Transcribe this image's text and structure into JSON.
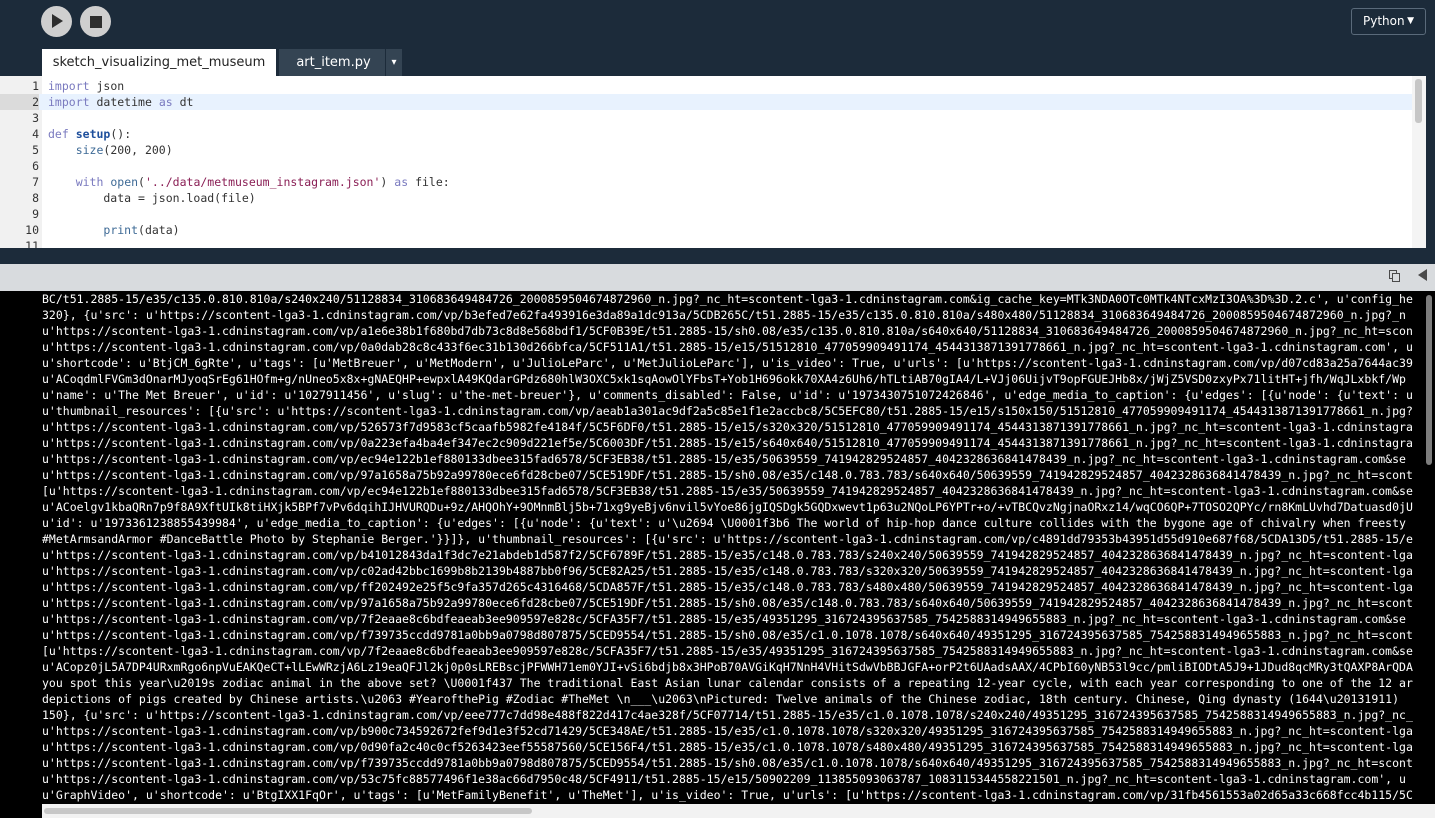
{
  "toolbar": {
    "run_icon": "play-icon",
    "stop_icon": "stop-icon",
    "mode": "Python",
    "mode_caret": "▼"
  },
  "tabs": [
    {
      "label": "sketch_visualizing_met_museum",
      "active": true
    },
    {
      "label": "art_item.py",
      "active": false
    }
  ],
  "tabs_menu": "▾",
  "editor": {
    "active_line": 2,
    "lines": [
      {
        "n": "1",
        "tokens": [
          [
            "kw",
            "import"
          ],
          [
            "",
            "json"
          ]
        ]
      },
      {
        "n": "2",
        "tokens": [
          [
            "kw",
            "import"
          ],
          [
            "",
            "datetime"
          ],
          [
            "kw",
            "as"
          ],
          [
            "",
            "dt"
          ]
        ]
      },
      {
        "n": "3",
        "tokens": []
      },
      {
        "n": "4",
        "tokens": [
          [
            "kw",
            "def"
          ],
          [
            "fn",
            "setup"
          ],
          [
            "",
            "():"
          ]
        ]
      },
      {
        "n": "5",
        "tokens": [
          [
            "",
            "    "
          ],
          [
            "bi",
            "size"
          ],
          [
            "",
            "(200, 200)"
          ]
        ]
      },
      {
        "n": "6",
        "tokens": []
      },
      {
        "n": "7",
        "tokens": [
          [
            "",
            "    "
          ],
          [
            "kw",
            "with"
          ],
          [
            "bi",
            "open"
          ],
          [
            "",
            "("
          ],
          [
            "str",
            "'../data/metmuseum_instagram.json'"
          ],
          [
            "",
            ")"
          ],
          [
            "kw",
            "as"
          ],
          [
            "",
            "file:"
          ]
        ]
      },
      {
        "n": "8",
        "tokens": [
          [
            "",
            "        data = json.load(file)"
          ]
        ]
      },
      {
        "n": "9",
        "tokens": []
      },
      {
        "n": "10",
        "tokens": [
          [
            "",
            "        "
          ],
          [
            "bi",
            "print"
          ],
          [
            "",
            "(data)"
          ]
        ]
      },
      {
        "n": "11",
        "tokens": []
      }
    ]
  },
  "console": {
    "copy_icon": "copy-icon",
    "collapse_icon": "collapse-left-icon",
    "lines": [
      "BC/t51.2885-15/e35/c135.0.810.810a/s240x240/51128834_310683649484726_2000859504674872960_n.jpg?_nc_ht=scontent-lga3-1.cdninstagram.com&ig_cache_key=MTk3NDA0OTc0MTk4NTcxMzI3OA%3D%3D.2.c', u'config_he",
      "320}, {u'src': u'https://scontent-lga3-1.cdninstagram.com/vp/b3efed7e62fa493916e3da89a1dc913a/5CDB265C/t51.2885-15/e35/c135.0.810.810a/s480x480/51128834_310683649484726_2000859504674872960_n.jpg?_n",
      "u'https://scontent-lga3-1.cdninstagram.com/vp/a1e6e38b1f680bd7db73c8d8e568bdf1/5CF0B39E/t51.2885-15/sh0.08/e35/c135.0.810.810a/s640x640/51128834_310683649484726_2000859504674872960_n.jpg?_nc_ht=scon",
      "u'https://scontent-lga3-1.cdninstagram.com/vp/0a0dab28c8c433f6ec31b130d266bfca/5CF511A1/t51.2885-15/e15/51512810_477059909491174_4544313871391778661_n.jpg?_nc_ht=scontent-lga3-1.cdninstagram.com', u",
      "u'shortcode': u'BtjCM_6gRte', u'tags': [u'MetBreuer', u'MetModern', u'JulioLeParc', u'MetJulioLeParc'], u'is_video': True, u'urls': [u'https://scontent-lga3-1.cdninstagram.com/vp/d07cd83a25a7644ac39",
      "u'ACoqdmlFVGm3dOnarMJyoqSrEg61HOfm+g/nUneo5x8x+gNAEQHP+ewpxlA49KQdarGPdz680hlW3OXC5xk1sqAowOlYFbsT+Yob1H696okk70XA4z6Uh6/hTLtiAB70gIA4/L+VJj06UijvT9opFGUEJHb8x/jWjZ5VSD0zxyPx71litHT+jfh/WqJLxbkf/Wp",
      "u'name': u'The Met Breuer', u'id': u'1027911456', u'slug': u'the-met-breuer'}, u'comments_disabled': False, u'id': u'1973430751072426846', u'edge_media_to_caption': {u'edges': [{u'node': {u'text': u",
      "u'thumbnail_resources': [{u'src': u'https://scontent-lga3-1.cdninstagram.com/vp/aeab1a301ac9df2a5c85e1f1e2accbc8/5C5EFC80/t51.2885-15/e15/s150x150/51512810_477059909491174_4544313871391778661_n.jpg?",
      "u'https://scontent-lga3-1.cdninstagram.com/vp/526573f7d9583cf5caafb5982fe4184f/5C5F6DF0/t51.2885-15/e15/s320x320/51512810_477059909491174_4544313871391778661_n.jpg?_nc_ht=scontent-lga3-1.cdninstagra",
      "u'https://scontent-lga3-1.cdninstagram.com/vp/0a223efa4ba4ef347ec2c909d221ef5e/5C6003DF/t51.2885-15/e15/s640x640/51512810_477059909491174_4544313871391778661_n.jpg?_nc_ht=scontent-lga3-1.cdninstagra",
      "u'https://scontent-lga3-1.cdninstagram.com/vp/ec94e122b1ef880133dbee315fad6578/5CF3EB38/t51.2885-15/e35/50639559_741942829524857_4042328636841478439_n.jpg?_nc_ht=scontent-lga3-1.cdninstagram.com&se",
      "u'https://scontent-lga3-1.cdninstagram.com/vp/97a1658a75b92a99780ece6fd28cbe07/5CE519DF/t51.2885-15/sh0.08/e35/c148.0.783.783/s640x640/50639559_741942829524857_4042328636841478439_n.jpg?_nc_ht=scont",
      "[u'https://scontent-lga3-1.cdninstagram.com/vp/ec94e122b1ef880133dbee315fad6578/5CF3EB38/t51.2885-15/e35/50639559_741942829524857_4042328636841478439_n.jpg?_nc_ht=scontent-lga3-1.cdninstagram.com&se",
      "u'ACoelgv1kbaQRn7p9f8A9XftUIk8tiHXjk5BPf7vPv6dqihIJHVURQDu+9z/AHQOhY+9OMnmBlj5b+71xg9yeBjv6nvil5vYoe86jgIQSDgk5GQDxwevt1p63u2NQoLP6YPTr+o/+vTBCQvzNgjnaORxz14/wqCO6QP+7TOSO2QPYc/rn8KmLUvhd7Datuasd0jU",
      "u'id': u'1973361238855439984', u'edge_media_to_caption': {u'edges': [{u'node': {u'text': u'\\u2694 \\U0001f3b6 The world of hip-hop dance culture collides with the bygone age of chivalry when freesty",
      "#MetArmsandArmor #DanceBattle Photo by Stephanie Berger.'}}]}, u'thumbnail_resources': [{u'src': u'https://scontent-lga3-1.cdninstagram.com/vp/c4891dd79353b43951d55d910e687f68/5CDA13D5/t51.2885-15/e",
      "u'https://scontent-lga3-1.cdninstagram.com/vp/b41012843da1f3dc7e21abdeb1d587f2/5CF6789F/t51.2885-15/e35/c148.0.783.783/s240x240/50639559_741942829524857_4042328636841478439_n.jpg?_nc_ht=scontent-lga",
      "u'https://scontent-lga3-1.cdninstagram.com/vp/c02ad42bbc1699b8b2139b4887bb0f96/5CE82A25/t51.2885-15/e35/c148.0.783.783/s320x320/50639559_741942829524857_4042328636841478439_n.jpg?_nc_ht=scontent-lga",
      "u'https://scontent-lga3-1.cdninstagram.com/vp/ff202492e25f5c9fa357d265c4316468/5CDA857F/t51.2885-15/e35/c148.0.783.783/s480x480/50639559_741942829524857_4042328636841478439_n.jpg?_nc_ht=scontent-lga",
      "u'https://scontent-lga3-1.cdninstagram.com/vp/97a1658a75b92a99780ece6fd28cbe07/5CE519DF/t51.2885-15/sh0.08/e35/c148.0.783.783/s640x640/50639559_741942829524857_4042328636841478439_n.jpg?_nc_ht=scont",
      "u'https://scontent-lga3-1.cdninstagram.com/vp/7f2eaae8c6bdfeaeab3ee909597e828c/5CFA35F7/t51.2885-15/e35/49351295_316724395637585_7542588314949655883_n.jpg?_nc_ht=scontent-lga3-1.cdninstagram.com&se",
      "u'https://scontent-lga3-1.cdninstagram.com/vp/f739735ccdd9781a0bb9a0798d807875/5CED9554/t51.2885-15/sh0.08/e35/c1.0.1078.1078/s640x640/49351295_316724395637585_7542588314949655883_n.jpg?_nc_ht=scont",
      "[u'https://scontent-lga3-1.cdninstagram.com/vp/7f2eaae8c6bdfeaeab3ee909597e828c/5CFA35F7/t51.2885-15/e35/49351295_316724395637585_7542588314949655883_n.jpg?_nc_ht=scontent-lga3-1.cdninstagram.com&se",
      "u'ACopz0jL5A7DP4URxmRgo6npVuEAKQeCT+lLEwWRzjA6Lz19eaQFJl2kj0p0sLREBscjPFWWH71em0YJI+vSi6bdjb8x3HPoB70AVGiKqH7NnH4VHitSdwVbBBJGFA+orP2t6UAadsAAX/4CPbI60yNB53l9cc/pmliBIODtA5J9+1JDud8qcMRy3tQAXP8ArQDA",
      "you spot this year\\u2019s zodiac animal in the above set? \\U0001f437 The traditional East Asian lunar calendar consists of a repeating 12-year cycle, with each year corresponding to one of the 12 ar",
      "depictions of pigs created by Chinese artists.\\u2063 #YearofthePig #Zodiac #TheMet \\n___\\u2063\\nPictured: Twelve animals of the Chinese zodiac, 18th century. Chinese, Qing dynasty (1644\\u20131911)",
      "150}, {u'src': u'https://scontent-lga3-1.cdninstagram.com/vp/eee777c7dd98e488f822d417c4ae328f/5CF07714/t51.2885-15/e35/c1.0.1078.1078/s240x240/49351295_316724395637585_7542588314949655883_n.jpg?_nc_",
      "u'https://scontent-lga3-1.cdninstagram.com/vp/b900c734592672fef9d1e3f52cd71429/5CE348AE/t51.2885-15/e35/c1.0.1078.1078/s320x320/49351295_316724395637585_7542588314949655883_n.jpg?_nc_ht=scontent-lga",
      "u'https://scontent-lga3-1.cdninstagram.com/vp/0d90fa2c40c0cf5263423eef55587560/5CE156F4/t51.2885-15/e35/c1.0.1078.1078/s480x480/49351295_316724395637585_7542588314949655883_n.jpg?_nc_ht=scontent-lga",
      "u'https://scontent-lga3-1.cdninstagram.com/vp/f739735ccdd9781a0bb9a0798d807875/5CED9554/t51.2885-15/sh0.08/e35/c1.0.1078.1078/s640x640/49351295_316724395637585_7542588314949655883_n.jpg?_nc_ht=scont",
      "u'https://scontent-lga3-1.cdninstagram.com/vp/53c75fc88577496f1e38ac66d7950c48/5CF4911/t51.2885-15/e15/50902209_113855093063787_1083115344558221501_n.jpg?_nc_ht=scontent-lga3-1.cdninstagram.com', u",
      "u'GraphVideo', u'shortcode': u'BtgIXX1FqOr', u'tags': [u'MetFamilyBenefit', u'TheMet'], u'is_video': True, u'urls': [u'https://scontent-lga3-1.cdninstagram.com/vp/31fb4561553a02d65a33c668fcc4b115/5C"
    ]
  }
}
